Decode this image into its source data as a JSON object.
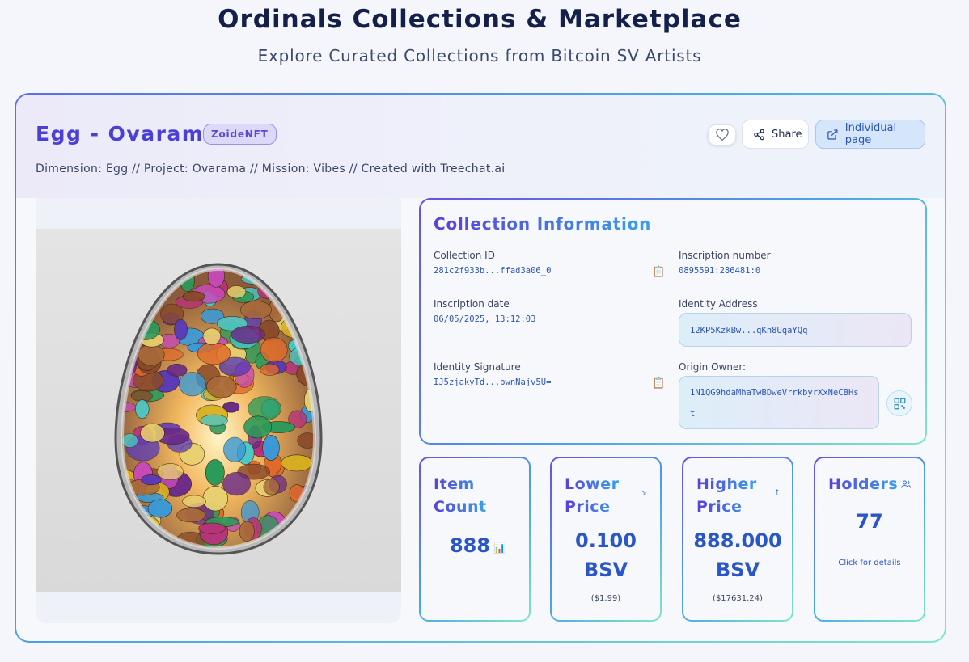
{
  "page": {
    "title": "Ordinals Collections & Marketplace",
    "subtitle": "Explore Curated Collections from Bitcoin SV Artists"
  },
  "item": {
    "title": "Egg - Ovarama",
    "creator_badge": "ZoideNFT",
    "description": "Dimension: Egg // Project: Ovarama // Mission: Vibes // Created with Treechat.ai",
    "share_label": "Share",
    "individual_page_label": "Individual page"
  },
  "info": {
    "title": "Collection Information",
    "collection_id_label": "Collection ID",
    "collection_id": "281c2f933b...ffad3a06_0",
    "inscription_number_label": "Inscription number",
    "inscription_number": "0895591:286481:0",
    "inscription_date_label": "Inscription date",
    "inscription_date": "06/05/2025, 13:12:03",
    "identity_address_label": "Identity Address",
    "identity_address": "12KP5KzkBw...qKn8UqaYQq",
    "identity_signature_label": "Identity Signature",
    "identity_signature": "IJ5zjakyTd...bwnNajv5U=",
    "origin_owner_label": "Origin Owner:",
    "origin_owner_line1": "1N1QG9hdaMhaTwBDweVrrkbyrXxNeCBHs",
    "origin_owner_line2": "t"
  },
  "stats": {
    "item_count": {
      "label_1": "Item",
      "label_2": "Count",
      "value": "888",
      "icon": "bar-chart-icon"
    },
    "lower_price": {
      "label_1": "Lower",
      "label_2": "Price",
      "value_1": "0.100",
      "value_2": "BSV",
      "usd": "($1.99)",
      "icon": "trend-down-icon"
    },
    "higher_price": {
      "label_1": "Higher",
      "label_2": "Price",
      "value_1": "888.000",
      "value_2": "BSV",
      "usd": "($17631.24)",
      "icon": "arrow-up-icon"
    },
    "holders": {
      "label": "Holders",
      "value": "77",
      "sub": "Click for details",
      "icon": "users-icon"
    }
  },
  "colors": {
    "accent_purple": "#4b3fd8",
    "accent_blue": "#2a56c8",
    "border_gradient_start": "#5b6ee8",
    "border_gradient_end": "#7ee8c6"
  }
}
